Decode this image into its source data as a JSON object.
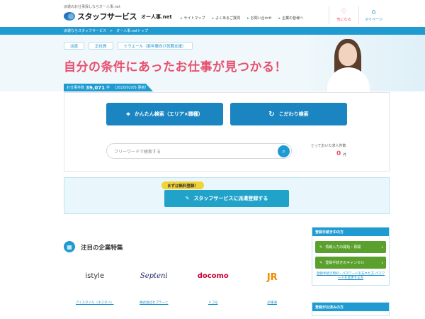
{
  "header": {
    "tagline": "派遣のお仕事探しならオー人事.net",
    "logo_text": "スタッフサービス",
    "logo_sub": "オー人事.net",
    "nav": [
      {
        "label": "サイトマップ"
      },
      {
        "label": "よくあるご質問"
      },
      {
        "label": "お問い合わせ"
      },
      {
        "label": "企業の皆様へ"
      }
    ],
    "favorites_label": "気になる",
    "mypage_label": "マイページ"
  },
  "breadcrumb": {
    "items": [
      "派遣ならスタッフサービス",
      "オー人事.netトップ"
    ],
    "separator": ">"
  },
  "hero": {
    "tabs": [
      {
        "label": "派遣"
      },
      {
        "label": "正社員"
      },
      {
        "label": "ミラエール（若年層向け就職支援）"
      }
    ],
    "title": "自分の条件にあったお仕事が見つかる！",
    "count_label": "お仕事件数",
    "count_value": "39,071",
    "count_unit": "件",
    "count_date": "（2020/02/05 更新）"
  },
  "search": {
    "easy_label": "かんたん検索（エリア×職種）",
    "detail_label": "こだわり検索",
    "keyword_placeholder": "フリーワードで検索する",
    "keyword_value": "",
    "saved_label": "とっておいた求人件数",
    "saved_count": "0",
    "saved_unit": "件"
  },
  "register": {
    "badge": "まずは無料登録！",
    "button_label": "スタッフサービスに派遣登録する"
  },
  "featured": {
    "title": "注目の企業特集",
    "companies": [
      {
        "logo": "istyle",
        "name": "アイスタイル（ホスタバ）"
      },
      {
        "logo": "Septeni",
        "name": "株式会社セプテーニ"
      },
      {
        "logo": "docomo",
        "name": "ドコモ"
      },
      {
        "logo": "JR",
        "name": "JR東海"
      }
    ]
  },
  "side": {
    "header": "登録手続き中の方",
    "btn_resume": "情報入力の開始・再開",
    "btn_cancel": "登録手続きのキャンセル",
    "note": "登録手続き用ID・パスワードを忘れた方 パスワードを変更する方",
    "header2": "登録がお済みの方"
  },
  "colors": {
    "brand_blue": "#1f9bd1",
    "title_pink": "#e8506e",
    "button_blue": "#1a85c0",
    "register_teal": "#21a3c9",
    "side_green": "#5aa02c",
    "badge_yellow": "#f2d335"
  }
}
